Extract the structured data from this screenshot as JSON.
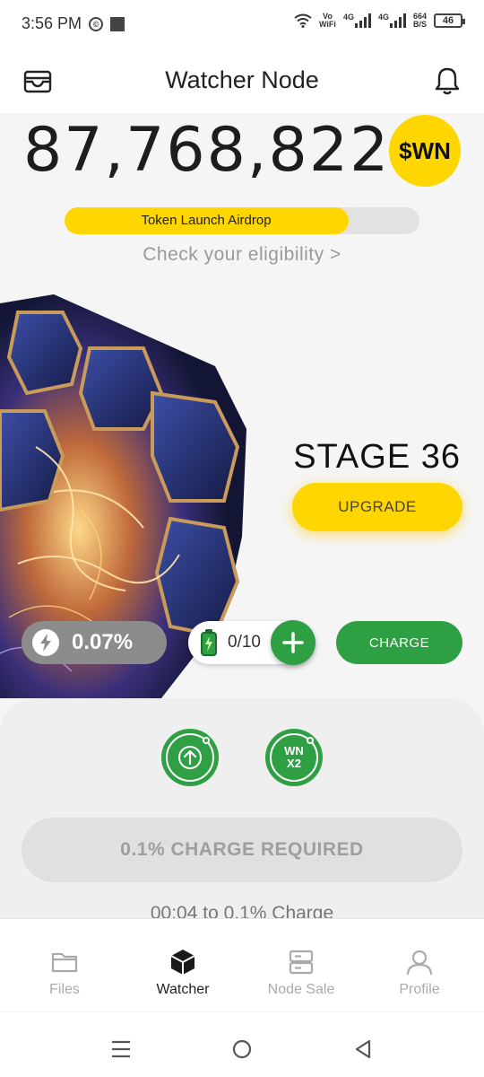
{
  "status_bar": {
    "time": "3:56 PM",
    "network_top": "Vo",
    "network_bottom": "WiFi",
    "signal1": "4G",
    "signal2": "4G",
    "speed_top": "664",
    "speed_bottom": "B/S",
    "battery": "46"
  },
  "header": {
    "title": "Watcher Node",
    "left_icon": "wallet-icon",
    "right_icon": "bell-icon"
  },
  "balance": {
    "amount": "87,768,822",
    "token": "$WN"
  },
  "airdrop": {
    "label": "Token Launch Airdrop",
    "progress": 0.8,
    "color": "#ffd600"
  },
  "eligibility": {
    "text": "Check your eligibility",
    "chevron": ">"
  },
  "stage": {
    "label": "STAGE 36"
  },
  "upgrade": {
    "label": "UPGRADE"
  },
  "speed": {
    "value": "0.07%"
  },
  "battery_pack": {
    "count": "0/10"
  },
  "charge": {
    "label": "CHARGE"
  },
  "boosts": {
    "x2_label_top": "WN",
    "x2_label_bottom": "X2"
  },
  "charge_required": {
    "label": "0.1% CHARGE REQUIRED"
  },
  "timer": {
    "text": "00:04 to 0.1% Charge"
  },
  "nav": [
    {
      "label": "Files",
      "icon": "folder-icon",
      "active": false
    },
    {
      "label": "Watcher",
      "icon": "cube-icon",
      "active": true
    },
    {
      "label": "Node Sale",
      "icon": "server-icon",
      "active": false
    },
    {
      "label": "Profile",
      "icon": "person-icon",
      "active": false
    }
  ],
  "colors": {
    "accent_yellow": "#ffd600",
    "accent_green": "#2ea043"
  }
}
